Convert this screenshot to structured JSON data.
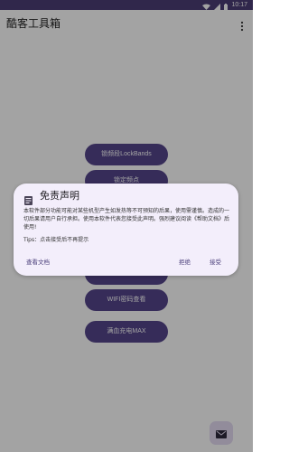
{
  "status_bar": {
    "time": "10:17",
    "icons": [
      "wifi-icon",
      "signal-icon",
      "battery-icon"
    ]
  },
  "app_bar": {
    "title": "酷客工具箱",
    "menu_icon": "more-vert-icon"
  },
  "main": {
    "buttons": [
      {
        "label": "锁频段LockBands"
      },
      {
        "label": "锁定频点"
      },
      {
        "label": ""
      },
      {
        "label": ""
      },
      {
        "label": ""
      },
      {
        "label": "WIFI密码查看"
      },
      {
        "label": "满血充电MAX"
      }
    ],
    "fab_icon": "mail-icon"
  },
  "dialog": {
    "icon": "document-icon",
    "title": "免责声明",
    "body": "本软件部分功能可能对某些机型产生如发热等不可预知的后果，使用需谨慎。造成的一切后果请用户自行承担。使用本软件代表您接受此声明。强烈建议阅读《帮助文档》后使用!",
    "tips": "Tips：点击接受后不再提示",
    "buttons": {
      "docs": "查看文档",
      "reject": "拒绝",
      "accept": "接受"
    }
  },
  "colors": {
    "status_bar": "#4b3d76",
    "button": "#55458c",
    "dialog_bg": "#f3eefb",
    "dialog_button_text": "#4a3e7a",
    "fab_bg": "#e4dcf3"
  }
}
